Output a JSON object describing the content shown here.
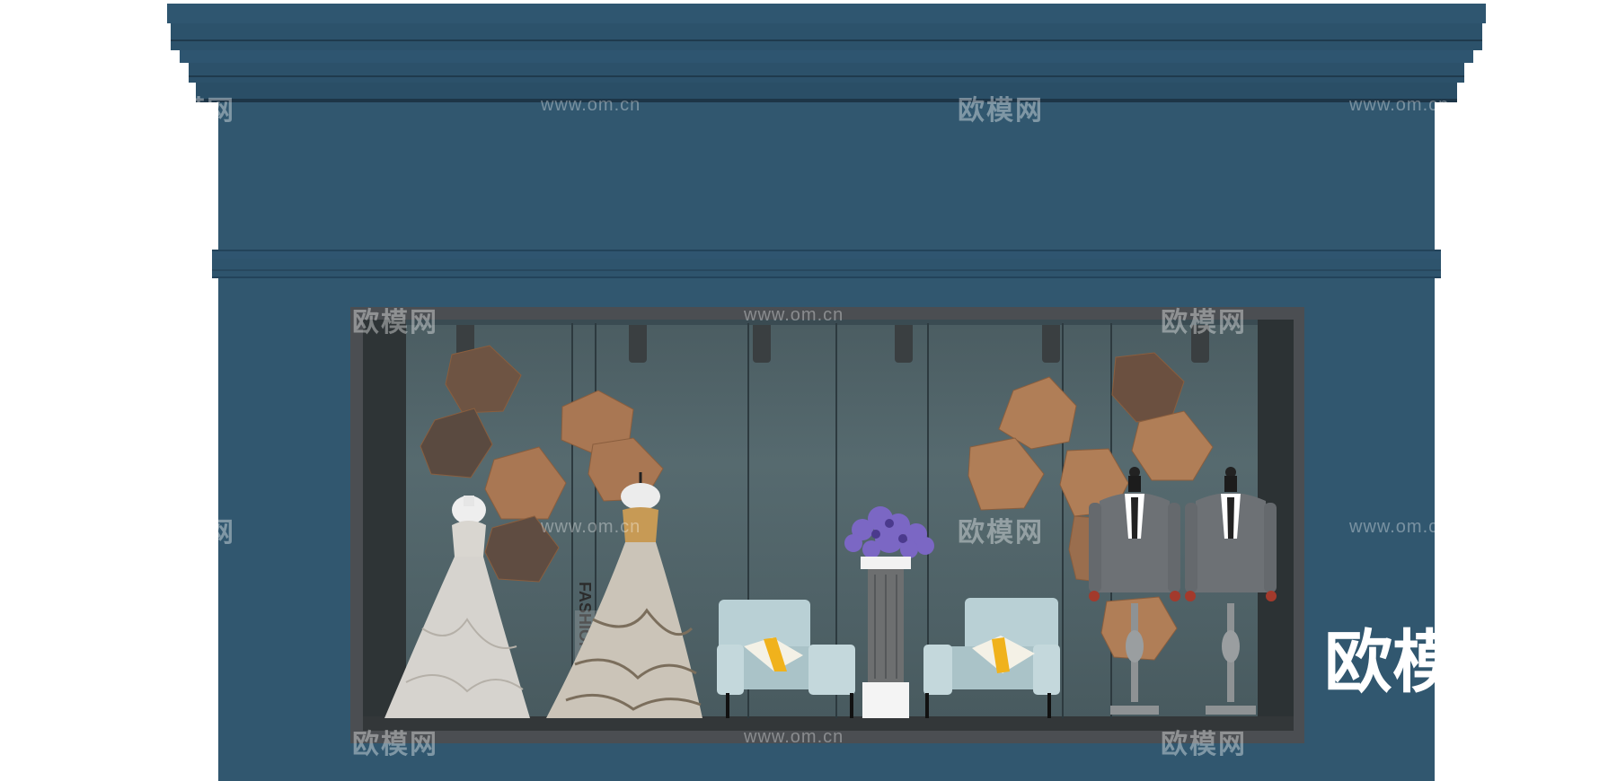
{
  "watermarks": {
    "domain_text": "www.om.cn",
    "brand_text": "欧模网",
    "domain_partial_left": "om.cn",
    "domain_partial_right": "www."
  },
  "logo_overlay": "欧模",
  "window_poster_text": "FASHION",
  "colors": {
    "facade": "#31576f",
    "window_frame": "#4b4e52",
    "backwall": "#566a6f",
    "copper_geometry": "#b07e57",
    "armchair": "#b9d0d5",
    "pillow_accent": "#f0b21c",
    "flowers": "#7b67c4"
  },
  "scene": {
    "mannequins": [
      "wedding-dress-left",
      "wedding-dress-right",
      "suit-left",
      "suit-right"
    ],
    "furniture": [
      "armchair-left",
      "armchair-right",
      "flower-pedestal"
    ]
  }
}
